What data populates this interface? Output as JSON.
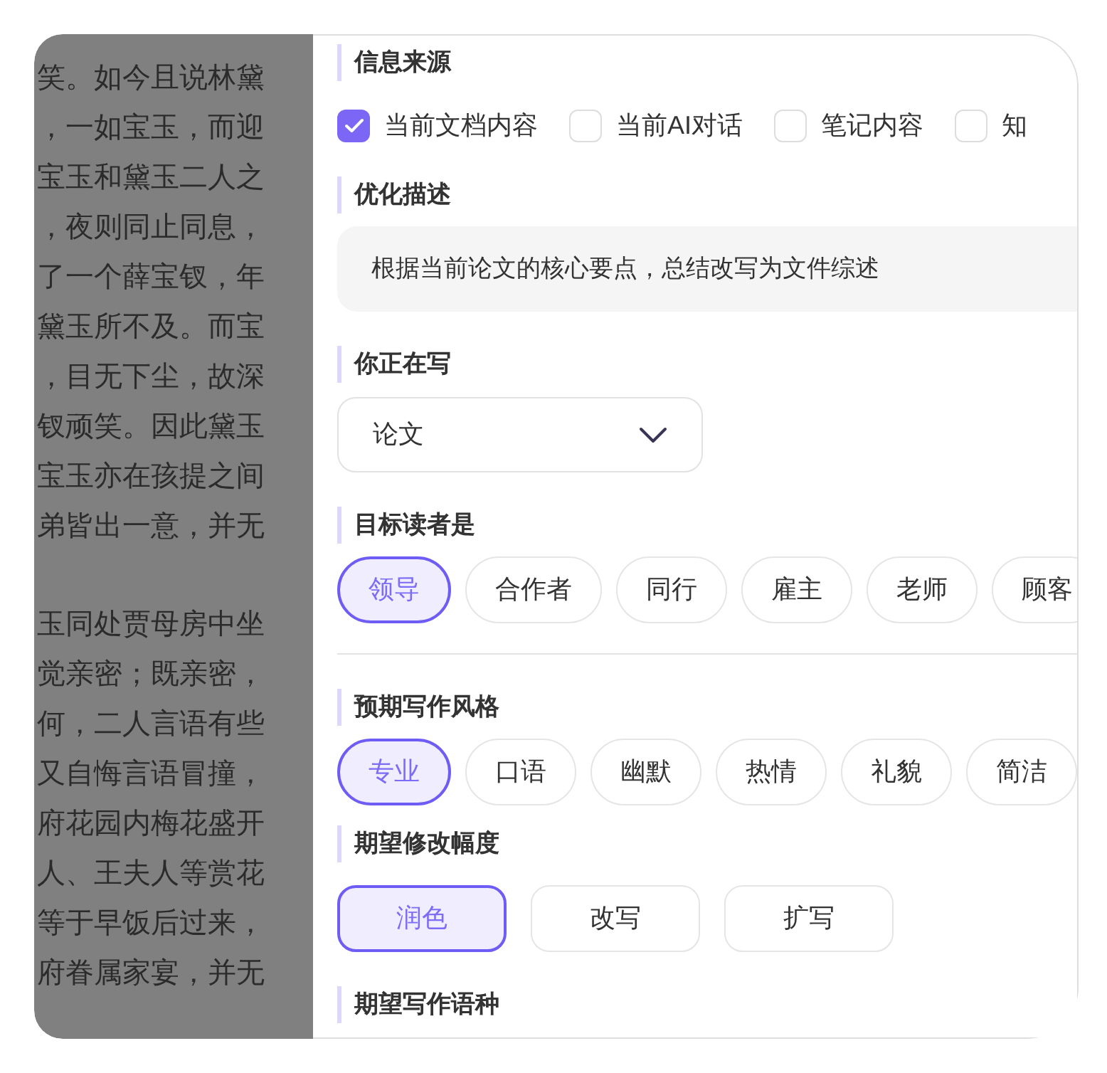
{
  "document_text": {
    "paragraphs": [
      [
        "笑。如今且说林黛",
        "，一如宝玉，而迎",
        "宝玉和黛玉二人之",
        "，夜则同止同息，",
        "了一个薛宝钗，年",
        "黛玉所不及。而宝",
        "，目无下尘，故深",
        "钗顽笑。因此黛玉",
        "宝玉亦在孩提之间",
        "弟皆出一意，并无"
      ],
      [
        "玉同处贾母房中坐",
        "觉亲密；既亲密，",
        "何，二人言语有些",
        "又自悔言语冒撞，",
        "府花园内梅花盛开",
        "人、王夫人等赏花",
        "等于早饭后过来，",
        "府眷属家宴，并无"
      ]
    ]
  },
  "panel": {
    "sections": [
      {
        "kind": "checkboxes",
        "title": "信息来源",
        "options": [
          {
            "label": "当前文档内容",
            "checked": true
          },
          {
            "label": "当前AI对话",
            "checked": false
          },
          {
            "label": "笔记内容",
            "checked": false
          },
          {
            "label": "知",
            "checked": false
          }
        ]
      },
      {
        "kind": "textarea",
        "title": "优化描述",
        "value": "根据当前论文的核心要点，总结改写为文件综述"
      },
      {
        "kind": "select",
        "title": "你正在写",
        "value": "论文"
      },
      {
        "kind": "pills",
        "title": "目标读者是",
        "options": [
          {
            "label": "领导",
            "selected": true
          },
          {
            "label": "合作者",
            "selected": false
          },
          {
            "label": "同行",
            "selected": false
          },
          {
            "label": "雇主",
            "selected": false
          },
          {
            "label": "老师",
            "selected": false
          },
          {
            "label": "顾客",
            "selected": false
          }
        ]
      },
      {
        "kind": "divider"
      },
      {
        "kind": "pills",
        "title": "预期写作风格",
        "options": [
          {
            "label": "专业",
            "selected": true
          },
          {
            "label": "口语",
            "selected": false
          },
          {
            "label": "幽默",
            "selected": false
          },
          {
            "label": "热情",
            "selected": false
          },
          {
            "label": "礼貌",
            "selected": false
          },
          {
            "label": "简洁",
            "selected": false
          }
        ]
      },
      {
        "kind": "buttons",
        "title": "期望修改幅度",
        "options": [
          {
            "label": "润色",
            "selected": true
          },
          {
            "label": "改写",
            "selected": false
          },
          {
            "label": "扩写",
            "selected": false
          }
        ]
      },
      {
        "kind": "heading",
        "title": "期望写作语种"
      }
    ]
  }
}
